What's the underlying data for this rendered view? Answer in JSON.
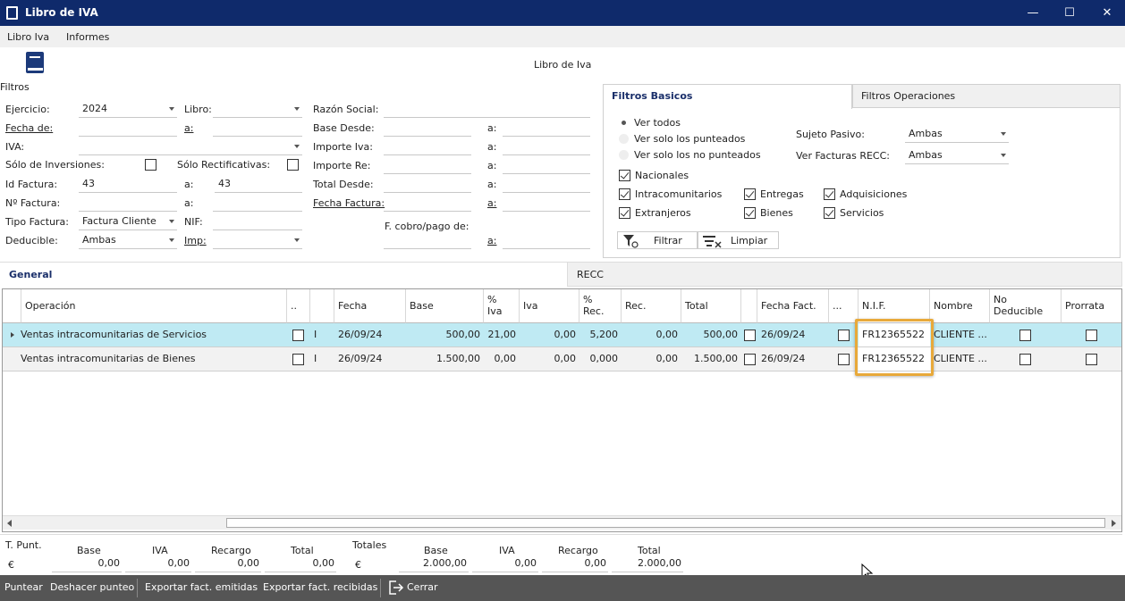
{
  "window": {
    "title": "Libro de IVA",
    "min": "—",
    "max": "☐",
    "close": "✕"
  },
  "menu": [
    "Libro Iva",
    "Informes"
  ],
  "header": {
    "icon": "book-icon",
    "filtros_label": "Filtros",
    "center_title": "Libro de Iva"
  },
  "left_filters": {
    "ejercicio_label": "Ejercicio:",
    "ejercicio_value": "2024",
    "libro_label": "Libro:",
    "libro_value": "",
    "fecha_de_label": "Fecha de:",
    "fecha_a_label": "a:",
    "iva_label": "IVA:",
    "solo_inversiones_label": "Sólo de Inversiones:",
    "solo_rectificativas_label": "Sólo Rectificativas:",
    "id_factura_label": "Id Factura:",
    "id_factura_value": "43",
    "id_a_label": "a:",
    "id_a_value": "43",
    "nro_factura_label": "Nº Factura:",
    "nro_a_label": "a:",
    "tipo_factura_label": "Tipo Factura:",
    "tipo_factura_value": "Factura Cliente",
    "nif_label": "NIF:",
    "deducible_label": "Deducible:",
    "deducible_value": "Ambas",
    "imp_label": "Imp:"
  },
  "mid_filters": {
    "razon_social": "Razón Social:",
    "base_desde": "Base Desde:",
    "importe_iva": "Importe Iva:",
    "importe_re": "Importe Re:",
    "total_desde": "Total Desde:",
    "fecha_factura": "Fecha Factura:",
    "f_cobro": "F. cobro/pago de:",
    "a": "a:"
  },
  "tabs_filters": {
    "basicos": "Filtros Basicos",
    "operaciones": "Filtros Operaciones"
  },
  "basic": {
    "ver_todos": "Ver todos",
    "ver_punteados": "Ver solo los punteados",
    "ver_no_punteados": "Ver solo los no punteados",
    "sujeto_pasivo_label": "Sujeto Pasivo:",
    "sujeto_pasivo_value": "Ambas",
    "recc_label": "Ver Facturas RECC:",
    "recc_value": "Ambas",
    "nacionales": "Nacionales",
    "intracomunitarios": "Intracomunitarios",
    "extranjeros": "Extranjeros",
    "entregas": "Entregas",
    "bienes": "Bienes",
    "adquisiciones": "Adquisiciones",
    "servicios": "Servicios",
    "filtrar": "Filtrar",
    "limpiar": "Limpiar"
  },
  "main_tabs": {
    "general": "General",
    "recc": "RECC"
  },
  "grid": {
    "headers": {
      "operacion": "Operación",
      "dots": "..",
      "fecha": "Fecha",
      "base": "Base",
      "piva": "%\nIva",
      "iva": "Iva",
      "prec": "%\nRec.",
      "rec": "Rec.",
      "total": "Total",
      "fecha_fact": "Fecha Fact.",
      "dots2": "...",
      "nif": "N.I.F.",
      "nombre": "Nombre",
      "no_deducible": "No\nDeducible",
      "prorrata": "Prorrata"
    },
    "rows": [
      {
        "operacion": "Ventas intracomunitarias de Servicios",
        "tipo": "I",
        "fecha": "26/09/24",
        "base": "500,00",
        "piva": "21,00",
        "iva": "0,00",
        "prec": "5,200",
        "rec": "0,00",
        "total": "500,00",
        "fecha_fact": "26/09/24",
        "nif": "FR12365522",
        "nombre": "CLIENTE ..."
      },
      {
        "operacion": "Ventas intracomunitarias de Bienes",
        "tipo": "I",
        "fecha": "26/09/24",
        "base": "1.500,00",
        "piva": "0,00",
        "iva": "0,00",
        "prec": "0,000",
        "rec": "0,00",
        "total": "1.500,00",
        "fecha_fact": "26/09/24",
        "nif": "FR12365522",
        "nombre": "CLIENTE ..."
      }
    ]
  },
  "totals": {
    "t_punt": "T. Punt.",
    "euro": "€",
    "base_label": "Base",
    "iva_label": "IVA",
    "recargo_label": "Recargo",
    "total_label": "Total",
    "p_base": "0,00",
    "p_iva": "0,00",
    "p_recargo": "0,00",
    "p_total": "0,00",
    "totales": "Totales",
    "t_base": "2.000,00",
    "t_iva": "0,00",
    "t_recargo": "0,00",
    "t_total": "2.000,00"
  },
  "bottom": {
    "puntear": "Puntear",
    "deshacer": "Deshacer punteo",
    "exp_emitidas": "Exportar fact. emitidas",
    "exp_recibidas": "Exportar fact. recibidas",
    "cerrar": "Cerrar"
  },
  "colors": {
    "title_bg": "#0f2a6b",
    "selected_row": "#bfeaf3",
    "highlight": "#e8a93a",
    "bottom_bar": "#555555"
  }
}
